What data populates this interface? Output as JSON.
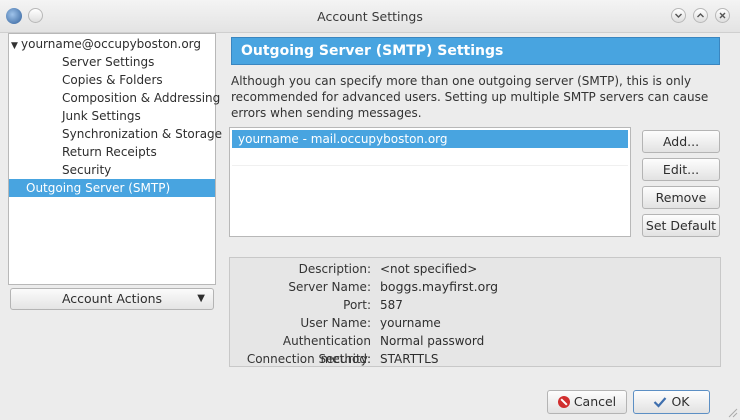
{
  "window": {
    "title": "Account Settings"
  },
  "sidebar": {
    "account": "yourname@occupyboston.org",
    "items": [
      "Server Settings",
      "Copies & Folders",
      "Composition & Addressing",
      "Junk Settings",
      "Synchronization & Storage",
      "Return Receipts",
      "Security"
    ],
    "selected": "Outgoing Server (SMTP)",
    "account_actions": "Account Actions"
  },
  "panel": {
    "header": "Outgoing Server (SMTP) Settings",
    "description": "Although you can specify more than one outgoing server (SMTP), this is only recommended for advanced users. Setting up multiple SMTP servers can cause errors when sending messages.",
    "servers": [
      "yourname - mail.occupyboston.org"
    ],
    "buttons": {
      "add": "Add...",
      "edit": "Edit...",
      "remove": "Remove",
      "set_default": "Set Default"
    }
  },
  "details": {
    "description_label": "Description:",
    "description_value": "<not specified>",
    "server_name_label": "Server Name:",
    "server_name_value": "boggs.mayfirst.org",
    "port_label": "Port:",
    "port_value": "587",
    "user_name_label": "User Name:",
    "user_name_value": "yourname",
    "auth_label": "Authentication method:",
    "auth_value": "Normal password",
    "security_label": "Connection Security:",
    "security_value": "STARTTLS"
  },
  "footer": {
    "cancel": "Cancel",
    "ok": "OK"
  },
  "colors": {
    "accent": "#48a4e0",
    "window_bg": "#ececec"
  }
}
